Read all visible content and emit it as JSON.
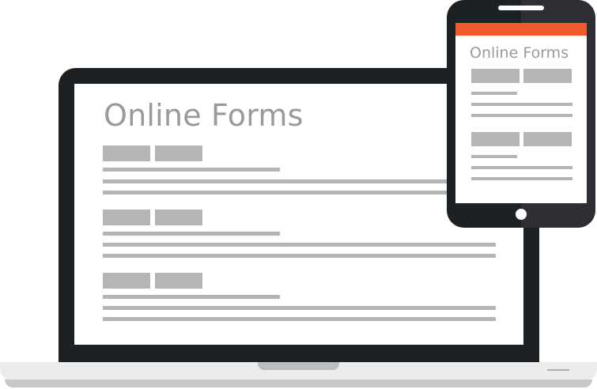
{
  "laptop": {
    "title": "Online Forms"
  },
  "phone": {
    "title": "Online Forms",
    "accent_color": "#f15a29"
  },
  "colors": {
    "device_frame": "#1e2124",
    "placeholder_gray": "#b5b5b5",
    "title_gray": "#9a9a9a"
  }
}
